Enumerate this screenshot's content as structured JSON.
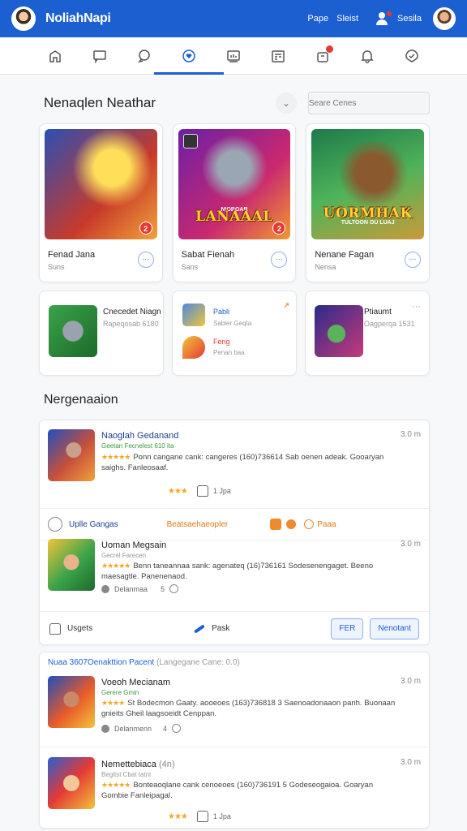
{
  "header": {
    "app_title": "NoliahNapi",
    "links": [
      "Pape",
      "Sleist",
      "Sesila"
    ]
  },
  "tabs": [
    {
      "icon": "home-icon"
    },
    {
      "icon": "chat-icon"
    },
    {
      "icon": "comment-icon"
    },
    {
      "icon": "heart-icon",
      "active": true
    },
    {
      "icon": "media-icon"
    },
    {
      "icon": "calendar-icon"
    },
    {
      "icon": "gift-icon",
      "badge": true
    },
    {
      "icon": "bell-icon"
    },
    {
      "icon": "settings-icon"
    }
  ],
  "featured": {
    "title": "Nenaqlen Neathar",
    "search_placeholder": "Seare Cenes",
    "cards": [
      {
        "title": "Fenad Jana",
        "sub": "Suns",
        "badge": "2"
      },
      {
        "title": "Sabat Fienah",
        "sub": "Sans",
        "logo": "LANAAAL",
        "sublogo": "NIGBOAR",
        "badge": "2"
      },
      {
        "title": "Nenane Fagan",
        "sub": "Nensa",
        "logo": "UORMHAK",
        "sublogo": "TULTOON OU LUAJ"
      }
    ]
  },
  "mini": [
    {
      "title": "Cnecedet Niagn",
      "sub": "Rapeqosab 6180"
    },
    {
      "line1_title": "Pabli",
      "line1_sub": "Sabler Geqta",
      "line2_title": "Feng",
      "line2_sub": "Penan baa",
      "tag": "↗"
    },
    {
      "title": "Ptiaumt",
      "sub": "Oagperqa 1531",
      "dots": "···"
    }
  ],
  "section2_title": "Nergenaaion",
  "list": [
    {
      "title": "Naoglah Gedanand",
      "meta": "Geetan Fecnelest 610 ita",
      "desc": "Ponn cangane cank: cangeres (160)736614 Sab oenen adeak. Gooaryan saighs. Fanleosaaf.",
      "time": "3.0 m",
      "rating": "★★★",
      "likes": "1 Jpa"
    },
    {
      "title": "Uoman Megsain",
      "meta": "Gecrel Farecen",
      "desc": "Benn taneannaa sank: agenateq (16)736161 Sodesenengaget. Beeno maesagtle. Panenenaod.",
      "time": "3.0 m",
      "info": "Delanmaa",
      "count": "5"
    },
    {
      "title": "Voeoh Mecianam",
      "meta": "Gerere Gmin",
      "desc": "St Bodecmon Gaaty. aooeoes (163)736818 3 Saenoadonaaon panh. Buonaan gnieits Gheil laagsoeidt Cenppan.",
      "time": "3.0 m",
      "info": "Delanmenn",
      "count": "4"
    },
    {
      "title": "Nemettebiaca",
      "title_suffix": "(4n)",
      "meta": "Begitst Cbat tatnl",
      "desc": "Bonteaoqlane cank cenoeoes (160)736191 5 Godeseogaioa. Goaryan Gombie Fanleipagal.",
      "time": "3.0 m",
      "rating": "★★★",
      "likes": "1 Jpa"
    }
  ],
  "strip": {
    "label": "Uplle Gangas",
    "mid": "Beatsaehaeopler",
    "right": "Paaa"
  },
  "actions": {
    "left": "Usgets",
    "mid": "Pask",
    "btn1": "FER",
    "btn2": "Nenotant"
  },
  "card2_header": {
    "main": "Nuaa 3607Oenakttion Pacent",
    "sub": "(Langegane Cane: 0.0)"
  }
}
